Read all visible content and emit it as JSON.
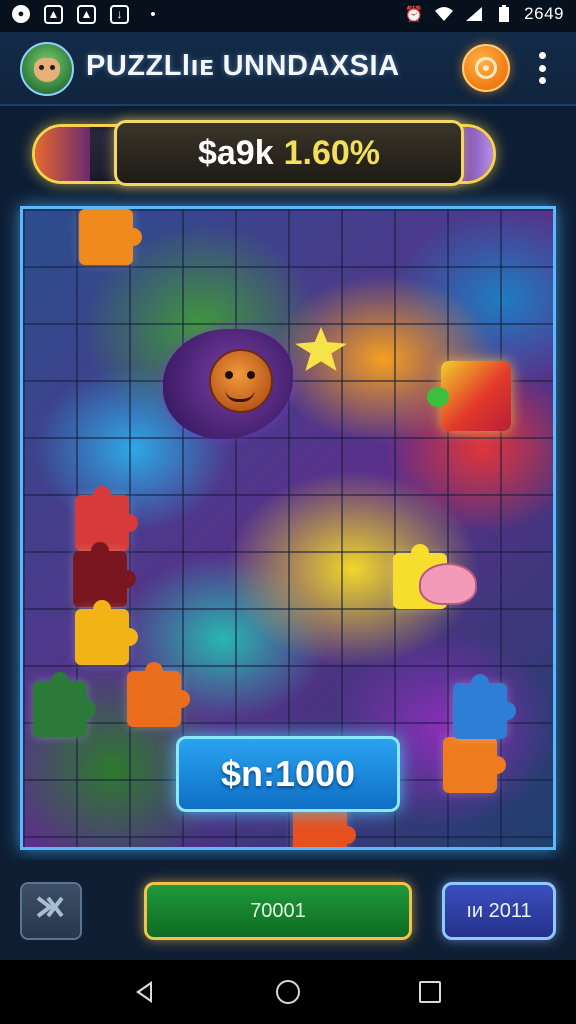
{
  "status_bar": {
    "time": "2649",
    "left_icons": [
      "message-icon",
      "image-icon",
      "photo-icon",
      "download-icon",
      "dot-icon"
    ],
    "right_icons": [
      "alarm-icon",
      "wifi-icon",
      "signal-icon",
      "battery-icon"
    ]
  },
  "header": {
    "title": "PUZZLlıᴇ UNNDAXSIA",
    "avatar_icon": "goblin-avatar-icon",
    "coin_icon": "coin-icon",
    "menu_icon": "more-vertical-icon"
  },
  "progress": {
    "amount": "$a9k",
    "percent": "1.60%",
    "fill_fraction": 0.12
  },
  "board": {
    "reward_label": "$n:1000",
    "sprites": [
      "monster-character-icon",
      "star-creature-icon",
      "puzzle-piece-icon",
      "slime-creature-icon"
    ]
  },
  "controls": {
    "shuffle_icon": "shuffle-icon",
    "primary_label": "70001",
    "secondary_label": "ıᴎ 2011"
  },
  "nav_bar": {
    "back_icon": "back-triangle-icon",
    "home_icon": "home-circle-icon",
    "recents_icon": "recents-square-icon"
  },
  "colors": {
    "accent_gold": "#f5d34a",
    "board_border": "#59b8ff",
    "primary_green": "#1f9a3a",
    "secondary_blue": "#3a4fc0",
    "coin_orange": "#f07a12"
  }
}
